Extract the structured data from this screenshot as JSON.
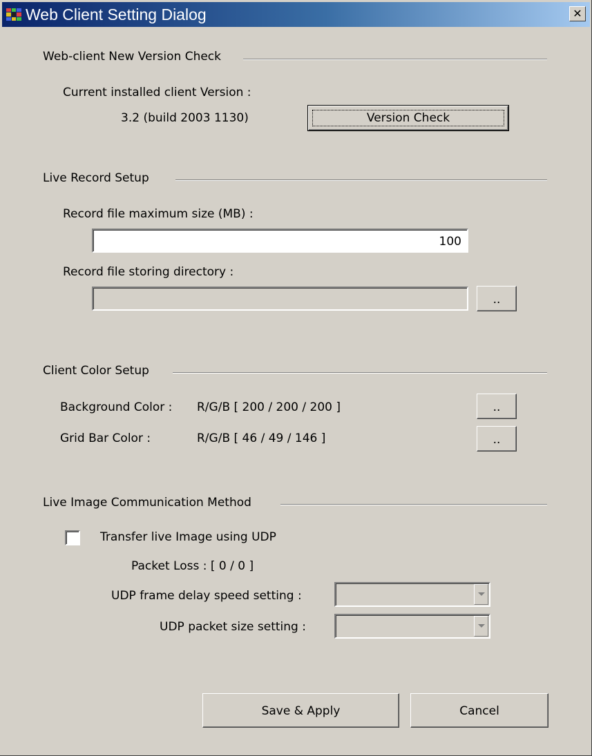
{
  "window": {
    "title": "Web Client Setting Dialog",
    "close_glyph": "✕",
    "icon": "app-icon"
  },
  "version_check": {
    "group_title": "Web-client New Version Check",
    "current_label": "Current installed client Version :",
    "version_value": "3.2  (build 2003 1130)",
    "button_label": "Version Check"
  },
  "record": {
    "group_title": "Live Record Setup",
    "max_size_label": "Record file maximum size (MB) :",
    "max_size_value": "100",
    "dir_label": "Record file storing directory :",
    "dir_value": "",
    "browse_label": ".."
  },
  "color": {
    "group_title": "Client Color Setup",
    "background_label": "Background Color :",
    "background_value": "R/G/B [ 200 / 200 / 200 ]",
    "background_button": "..",
    "grid_label": "Grid Bar Color :",
    "grid_value": "R/G/B [ 46 / 49 / 146 ]",
    "grid_button": ".."
  },
  "comm": {
    "group_title": "Live Image Communication Method",
    "udp_checkbox_label": "Transfer live Image using UDP",
    "udp_checked": false,
    "packet_loss": "Packet Loss : [ 0 / 0 ]",
    "delay_label": "UDP frame delay speed setting :",
    "delay_value": "",
    "packet_size_label": "UDP packet size setting :",
    "packet_size_value": ""
  },
  "footer": {
    "save_label": "Save & Apply",
    "cancel_label": "Cancel"
  }
}
